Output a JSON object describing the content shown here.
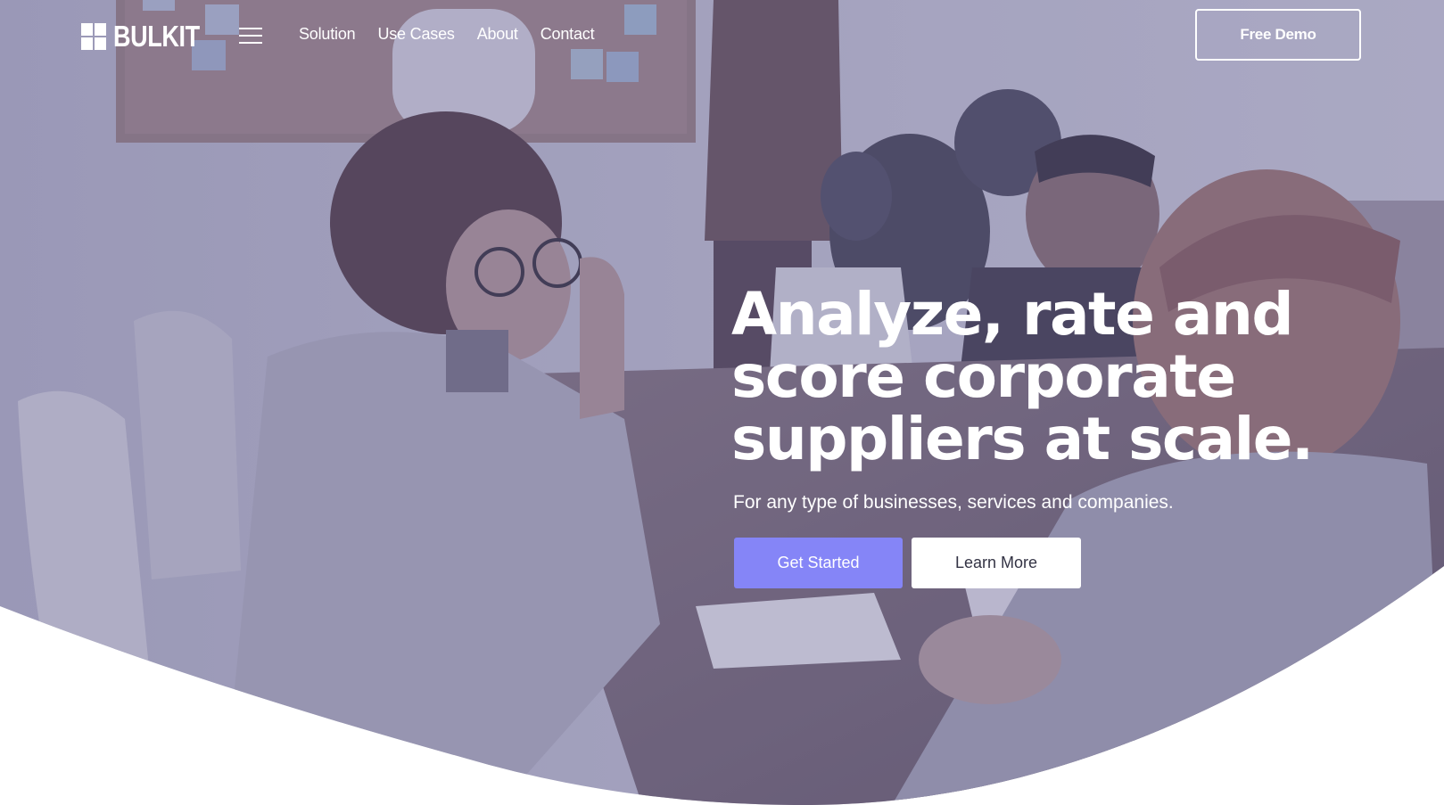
{
  "brand": {
    "name": "BULKIT",
    "accent_color": "#8585f7"
  },
  "nav": {
    "menu_icon": "hamburger-menu-icon",
    "links": [
      {
        "label": "Solution"
      },
      {
        "label": "Use Cases"
      },
      {
        "label": "About"
      },
      {
        "label": "Contact"
      }
    ],
    "cta_label": "Free Demo"
  },
  "hero": {
    "title": "Analyze, rate and score corporate suppliers at scale.",
    "subtitle": "For any type of businesses, services and companies.",
    "primary_button": "Get Started",
    "secondary_button": "Learn More",
    "background_image": "office-meeting-photo"
  }
}
